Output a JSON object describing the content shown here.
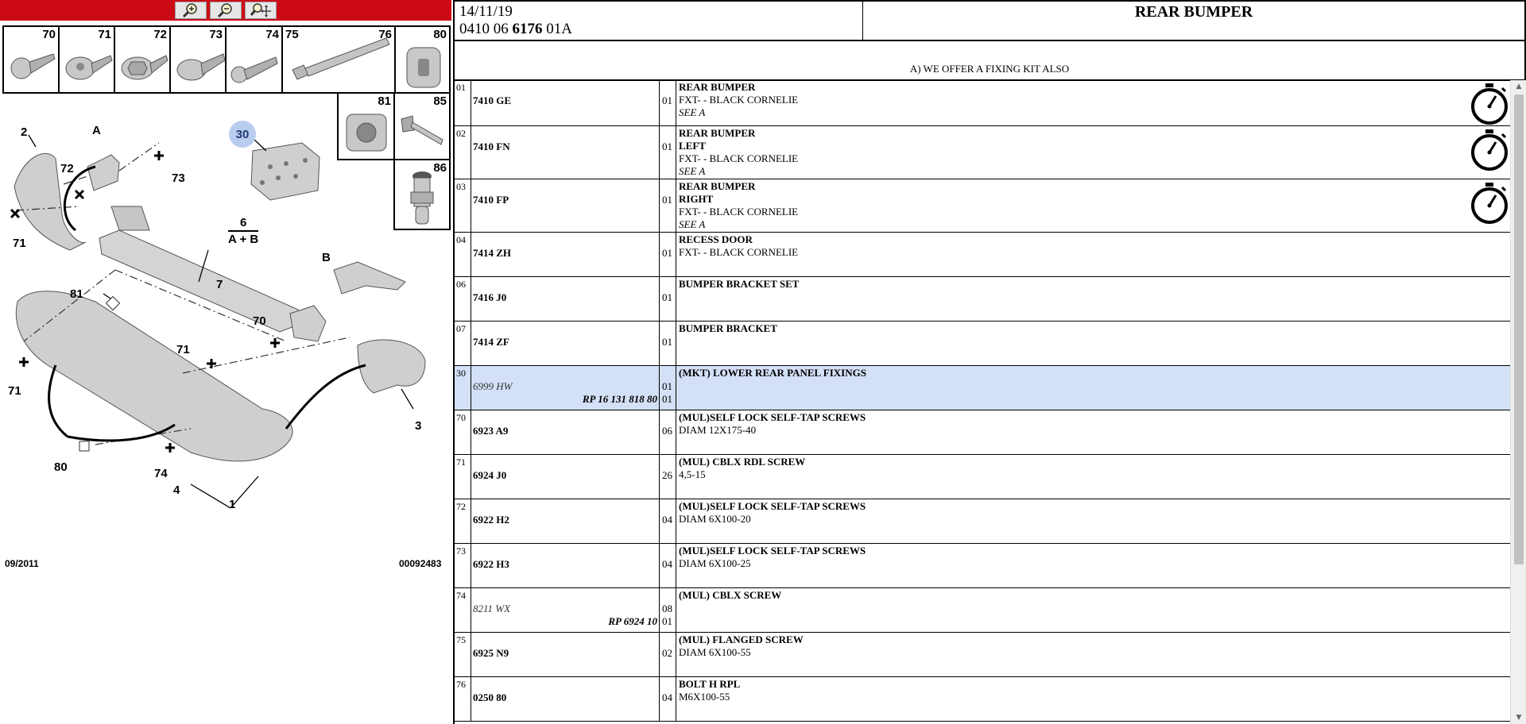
{
  "toolbar": {
    "buttons": [
      {
        "name": "zoom-in-icon"
      },
      {
        "name": "zoom-out-icon"
      },
      {
        "name": "zoom-move-icon"
      }
    ],
    "bg_color": "#cc0a16"
  },
  "thumbnails_row1": [
    "70",
    "71",
    "72",
    "73",
    "74",
    "75",
    "76",
    "80"
  ],
  "thumbnails_row2": [
    "81",
    "85"
  ],
  "thumbnail_row3": "86",
  "diagram": {
    "labels": [
      "2",
      "A",
      "72",
      "73",
      "71",
      "30",
      "6",
      "A + B",
      "7",
      "B",
      "81",
      "70",
      "71",
      "71",
      "3",
      "80",
      "74",
      "4",
      "1"
    ],
    "date": "09/2011",
    "code": "00092483"
  },
  "header": {
    "date": "14/11/19",
    "ref_prefix": "0410 06",
    "ref_bold": "6176",
    "ref_suffix": "01A",
    "title": "REAR BUMPER"
  },
  "note": "A) WE OFFER A FIXING KIT ALSO",
  "rows": [
    {
      "idx": "01",
      "ref": "7410 GE",
      "qty": "01",
      "lines": [
        "FXT- - BLACK CORNELIE"
      ],
      "title": "REAR BUMPER",
      "see": "SEE A",
      "timer": true
    },
    {
      "idx": "02",
      "ref": "7410 FN",
      "qty": "01",
      "title": "REAR BUMPER",
      "title2": "LEFT",
      "lines": [
        "FXT- - BLACK CORNELIE"
      ],
      "see": "SEE A",
      "timer": true
    },
    {
      "idx": "03",
      "ref": "7410 FP",
      "qty": "01",
      "title": "REAR BUMPER",
      "title2": "RIGHT",
      "lines": [
        "FXT- - BLACK CORNELIE"
      ],
      "see": "SEE A",
      "timer": true
    },
    {
      "idx": "04",
      "ref": "7414 ZH",
      "qty": "01",
      "title": "RECESS DOOR",
      "lines": [
        "FXT- - BLACK CORNELIE"
      ]
    },
    {
      "idx": "06",
      "ref": "7416 J0",
      "qty": "01",
      "title": "BUMPER BRACKET SET",
      "lines": []
    },
    {
      "idx": "07",
      "ref": "7414 ZF",
      "qty": "01",
      "title": "BUMPER BRACKET",
      "lines": []
    },
    {
      "idx": "30",
      "ref": "6999 HW",
      "ref_italic": true,
      "rp": "RP 16 131 818 80",
      "qty": "01",
      "qty2": "01",
      "title": "(MKT) LOWER REAR PANEL FIXINGS",
      "lines": [],
      "highlight": true
    },
    {
      "idx": "70",
      "ref": "6923 A9",
      "qty": "06",
      "title": "(MUL)SELF LOCK SELF-TAP SCREWS",
      "lines": [
        "DIAM 12X175-40"
      ]
    },
    {
      "idx": "71",
      "ref": "6924 J0",
      "qty": "26",
      "title": "(MUL) CBLX RDL SCREW",
      "lines": [
        "4,5-15"
      ]
    },
    {
      "idx": "72",
      "ref": "6922 H2",
      "qty": "04",
      "title": "(MUL)SELF LOCK SELF-TAP SCREWS",
      "lines": [
        "DIAM 6X100-20"
      ]
    },
    {
      "idx": "73",
      "ref": "6922 H3",
      "qty": "04",
      "title": "(MUL)SELF LOCK SELF-TAP SCREWS",
      "lines": [
        "DIAM 6X100-25"
      ]
    },
    {
      "idx": "74",
      "ref": "8211 WX",
      "ref_italic": true,
      "rp": "RP 6924 10",
      "qty": "08",
      "qty2": "01",
      "title": "(MUL) CBLX SCREW",
      "lines": []
    },
    {
      "idx": "75",
      "ref": "6925 N9",
      "qty": "02",
      "title": "(MUL) FLANGED SCREW",
      "lines": [
        "DIAM 6X100-55"
      ]
    },
    {
      "idx": "76",
      "ref": "0250 80",
      "qty": "04",
      "title": "BOLT H RPL",
      "lines": [
        "M6X100-55"
      ]
    }
  ]
}
